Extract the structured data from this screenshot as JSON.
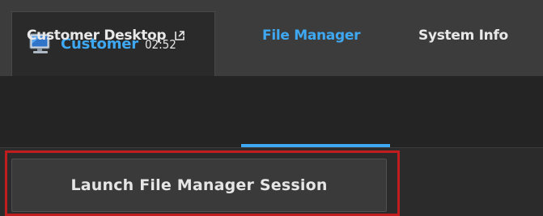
{
  "session_tab": {
    "title": "Customer",
    "time": "02:52",
    "icon": "monitor-icon"
  },
  "nav": {
    "items": [
      {
        "label": "Customer Desktop",
        "icon": "external-link-icon",
        "active": false
      },
      {
        "label": "File Manager",
        "active": true
      },
      {
        "label": "System Info",
        "active": false
      }
    ]
  },
  "main": {
    "launch_label": "Launch File Manager Session"
  },
  "colors": {
    "accent": "#3fa8f2",
    "highlight_border": "#c01e1e",
    "background": "#2b2b2b"
  }
}
